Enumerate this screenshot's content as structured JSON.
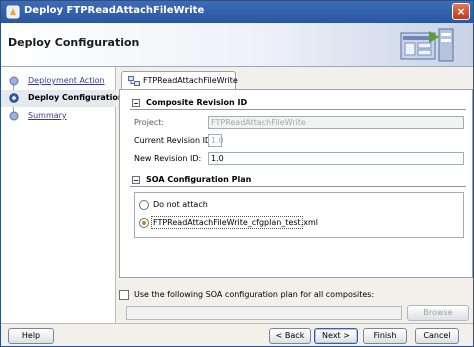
{
  "window": {
    "title": "Deploy FTPReadAttachFileWrite",
    "close_glyph": "×"
  },
  "header": {
    "page_title": "Deploy Configuration",
    "banner_icon": "deployment-graphic-icon"
  },
  "nav": {
    "items": [
      {
        "label": "Deployment Action",
        "state": "link"
      },
      {
        "label": "Deploy Configuration",
        "state": "active"
      },
      {
        "label": "Summary",
        "state": "link"
      }
    ]
  },
  "tab": {
    "label": "FTPReadAttachFileWrite",
    "icon": "composite-icon"
  },
  "composite_revision": {
    "title": "Composite Revision ID",
    "project_label": "Project:",
    "project_value": "FTPReadAttachFileWrite",
    "current_label": "Current Revision ID:",
    "current_value": "1.0",
    "new_label": "New Revision ID:",
    "new_value": "1.0"
  },
  "soa_plan": {
    "title": "SOA Configuration Plan",
    "options": [
      {
        "label": "Do not attach",
        "checked": false
      },
      {
        "label": "FTPReadAttachFileWrite_cfgplan_test.xml",
        "checked": true
      }
    ]
  },
  "bottom": {
    "checkbox_label": "Use the following SOA configuration plan for all composites:",
    "browse_label": "Browse"
  },
  "footer": {
    "help": "Help",
    "back": "< Back",
    "next": "Next >",
    "finish": "Finish",
    "cancel": "Cancel"
  },
  "colors": {
    "titlebar": "#2a56a0",
    "link": "#3b3a9a",
    "radio_selected": "#d07d1f"
  }
}
